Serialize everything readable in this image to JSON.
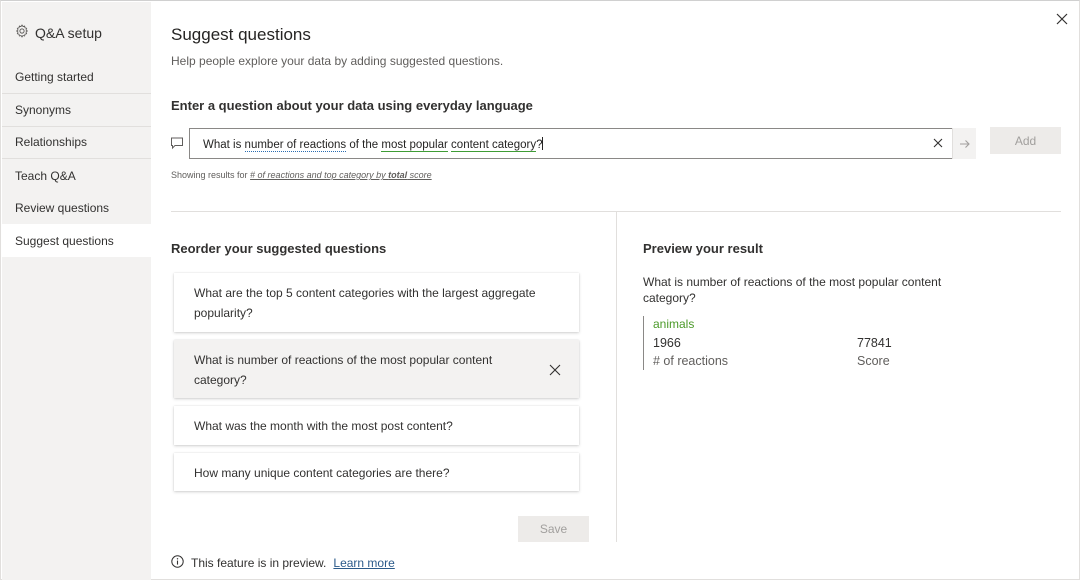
{
  "sidebar": {
    "header": "Q&A setup",
    "items": [
      {
        "label": "Getting started"
      },
      {
        "label": "Synonyms"
      },
      {
        "label": "Relationships"
      },
      {
        "label": "Teach Q&A"
      },
      {
        "label": "Review questions"
      },
      {
        "label": "Suggest questions"
      }
    ]
  },
  "main": {
    "title": "Suggest questions",
    "subtitle": "Help people explore your data by adding suggested questions.",
    "question_label": "Enter a question about your data using everyday language",
    "input": {
      "p1": "What is ",
      "p2": "number of reactions",
      "p3": " of the ",
      "p4": "most popular",
      "p5": " ",
      "p6": "content category",
      "p7": "?"
    },
    "add_label": "Add",
    "showing_prefix": "Showing results for ",
    "showing_link_a": "# of reactions and top category by ",
    "showing_link_b": "total",
    "showing_link_c": " score",
    "reorder_title": "Reorder your suggested questions",
    "suggested": [
      "What are the top 5 content categories with the largest aggregate popularity?",
      "What is number of reactions of the most popular content category?",
      "What was the month with the most post content?",
      "How many unique content categories are there?"
    ],
    "save_label": "Save",
    "preview_title": "Preview your result",
    "preview_question": "What is number of reactions of the most popular content category?",
    "preview": {
      "category": "animals",
      "value1": "1966",
      "label1": "# of reactions",
      "value2": "77841",
      "label2": "Score"
    },
    "footer_text": "This feature is in preview.",
    "footer_link": "Learn more"
  },
  "colors": {
    "accent_green": "#4c9a2a",
    "link_blue": "#2b5a8a",
    "sidebar_bg": "#f3f2f1"
  }
}
